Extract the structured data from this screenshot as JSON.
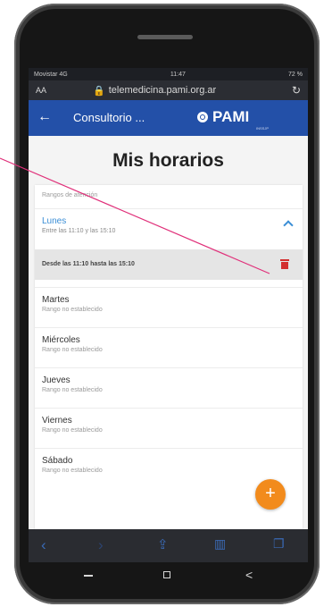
{
  "status": {
    "carrier": "Movistar 4G",
    "time": "11:47",
    "battery": "72 %"
  },
  "browser": {
    "aa": "AA",
    "url": "telemedicina.pami.org.ar",
    "reload_icon": "reload-icon"
  },
  "appbar": {
    "back_icon": "arrow-left-icon",
    "title": "Consultorio ...",
    "logo_text": "PAMI",
    "logo_subtext": "INSSJP"
  },
  "page": {
    "title": "Mis horarios"
  },
  "card": {
    "header": "Rangos de atención",
    "active_day": {
      "name": "Lunes",
      "subtitle": "Entre las 11:10 y las 15:10"
    },
    "range": {
      "text": "Desde las 11:10 hasta las 15:10",
      "delete_icon": "trash-icon"
    },
    "days": [
      {
        "name": "Martes",
        "subtitle": "Rango no establecido"
      },
      {
        "name": "Miércoles",
        "subtitle": "Rango no establecido"
      },
      {
        "name": "Jueves",
        "subtitle": "Rango no establecido"
      },
      {
        "name": "Viernes",
        "subtitle": "Rango no establecido"
      },
      {
        "name": "Sábado",
        "subtitle": "Rango no establecido"
      }
    ]
  },
  "fab": {
    "label": "+"
  },
  "browser_toolbar": {
    "back": "<",
    "forward": ">",
    "share": "share-icon",
    "bookmarks": "book-icon",
    "tabs": "tabs-icon"
  },
  "android_nav": {
    "back": "<"
  },
  "colors": {
    "appbar": "#2350a8",
    "accent": "#3a8ed6",
    "fab": "#f28b1c",
    "delete": "#d32f2f",
    "callout": "#e0307a"
  }
}
